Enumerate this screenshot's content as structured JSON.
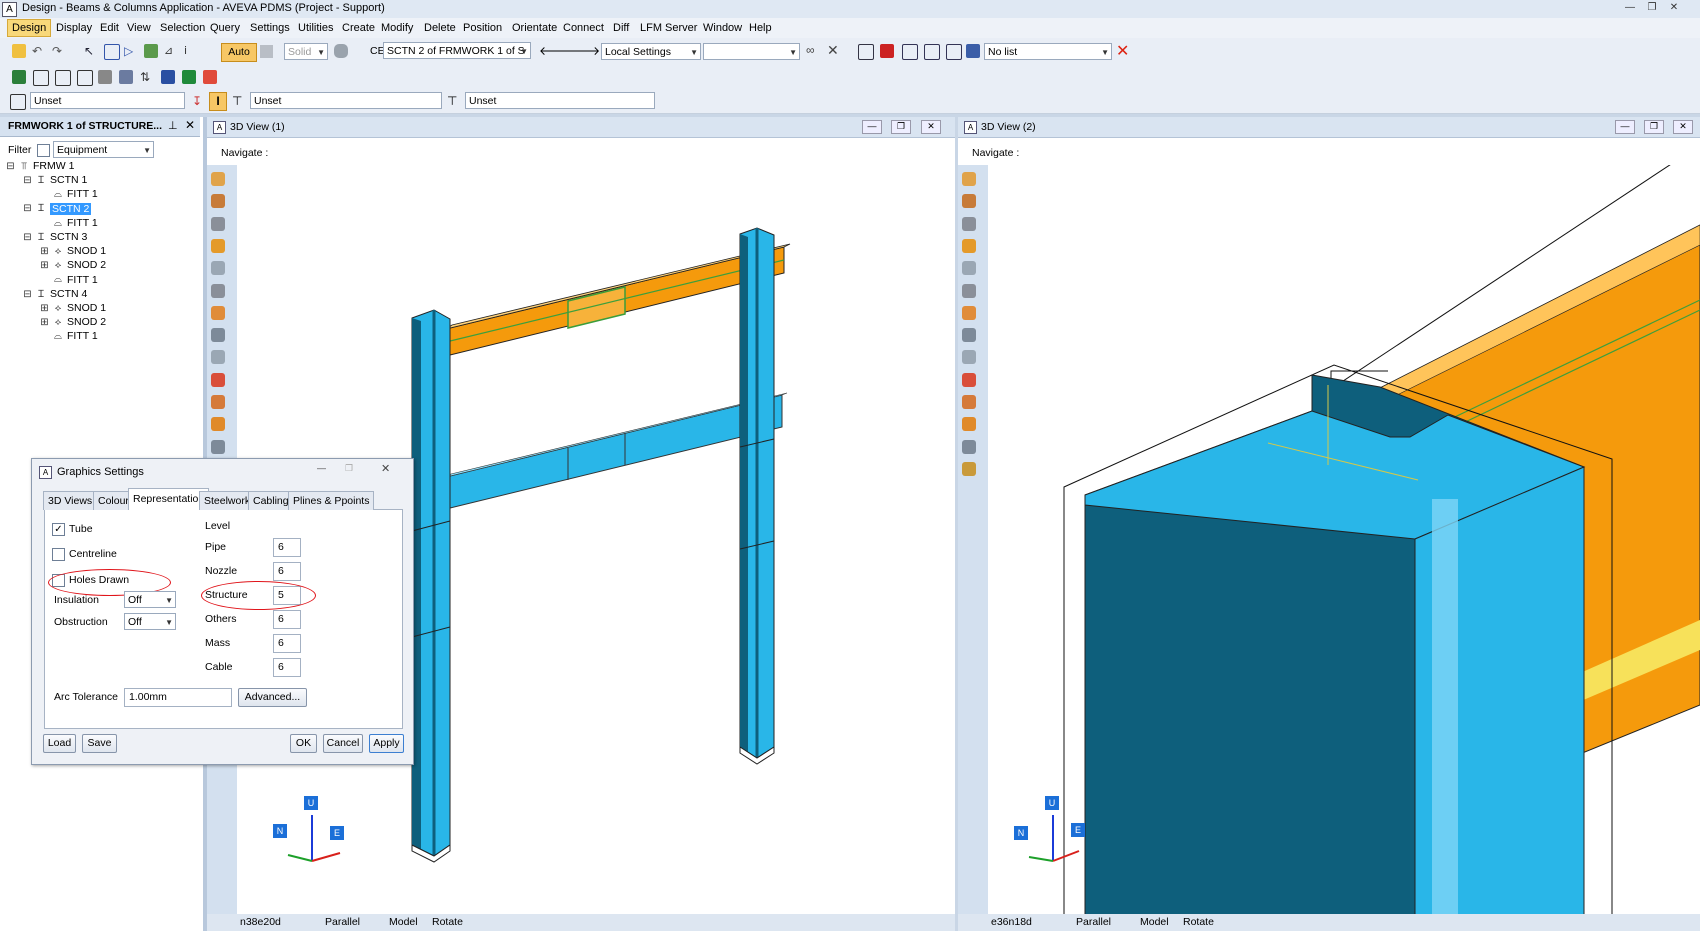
{
  "window": {
    "title": "Design - Beams & Columns Application - AVEVA PDMS (Project - Support)"
  },
  "menu": [
    "Design",
    "Display",
    "Edit",
    "View",
    "Selection",
    "Query",
    "Settings",
    "Utilities",
    "Create",
    "Modify",
    "Delete",
    "Position",
    "Orientate",
    "Connect",
    "Diff",
    "LFM Server",
    "Window",
    "Help"
  ],
  "toolbar": {
    "auto_label": "Auto",
    "solid_label": "Solid",
    "ce_label": "CE",
    "ce_value": "SCTN 2 of FRMWORK 1 of S",
    "settings_value": "Local Settings",
    "list_value": "No list",
    "unset1": "Unset",
    "unset2": "Unset",
    "unset3": "Unset"
  },
  "explorer": {
    "title": "FRMWORK 1 of STRUCTURE...",
    "filter_label": "Filter",
    "filter_value": "Equipment",
    "tree": [
      {
        "label": "FRMW 1",
        "level": 0,
        "icon": "frame-icon",
        "expander": "⊟",
        "selected": false
      },
      {
        "label": "SCTN 1",
        "level": 1,
        "icon": "beam-icon",
        "expander": "⊟",
        "selected": false
      },
      {
        "label": "FITT 1",
        "level": 2,
        "icon": "fitting-icon",
        "expander": "",
        "selected": false
      },
      {
        "label": "SCTN 2",
        "level": 1,
        "icon": "beam-icon",
        "expander": "⊟",
        "selected": true
      },
      {
        "label": "FITT 1",
        "level": 2,
        "icon": "fitting-icon",
        "expander": "",
        "selected": false
      },
      {
        "label": "SCTN 3",
        "level": 1,
        "icon": "beam-icon",
        "expander": "⊟",
        "selected": false
      },
      {
        "label": "SNOD 1",
        "level": 2,
        "icon": "node-icon",
        "expander": "⊞",
        "selected": false
      },
      {
        "label": "SNOD 2",
        "level": 2,
        "icon": "node-icon",
        "expander": "⊞",
        "selected": false
      },
      {
        "label": "FITT 1",
        "level": 2,
        "icon": "fitting-icon",
        "expander": "",
        "selected": false
      },
      {
        "label": "SCTN 4",
        "level": 1,
        "icon": "beam-icon",
        "expander": "⊟",
        "selected": false
      },
      {
        "label": "SNOD 1",
        "level": 2,
        "icon": "node-icon",
        "expander": "⊞",
        "selected": false
      },
      {
        "label": "SNOD 2",
        "level": 2,
        "icon": "node-icon",
        "expander": "⊞",
        "selected": false
      },
      {
        "label": "FITT 1",
        "level": 2,
        "icon": "fitting-icon",
        "expander": "",
        "selected": false
      }
    ]
  },
  "view1": {
    "title": "3D View (1)",
    "navigate_label": "Navigate :",
    "status": {
      "direction": "n38e20d",
      "projection": "Parallel",
      "mode": "Model",
      "action": "Rotate"
    }
  },
  "view2": {
    "title": "3D View (2)",
    "navigate_label": "Navigate :",
    "status": {
      "direction": "e36n18d",
      "projection": "Parallel",
      "mode": "Model",
      "action": "Rotate"
    }
  },
  "axes": {
    "up": "U",
    "north": "N",
    "east": "E"
  },
  "dialog": {
    "title": "Graphics Settings",
    "tabs": [
      "3D Views",
      "Colour",
      "Representation",
      "Steelwork",
      "Cabling",
      "Plines & Ppoints"
    ],
    "active_tab": "Representation",
    "tube": {
      "label": "Tube",
      "checked": true
    },
    "centreline": {
      "label": "Centreline",
      "checked": false
    },
    "holes_drawn": {
      "label": "Holes Drawn",
      "checked": false
    },
    "insulation": {
      "label": "Insulation",
      "value": "Off"
    },
    "obstruction": {
      "label": "Obstruction",
      "value": "Off"
    },
    "level_title": "Level",
    "levels": [
      {
        "label": "Pipe",
        "value": "6"
      },
      {
        "label": "Nozzle",
        "value": "6"
      },
      {
        "label": "Structure",
        "value": "5"
      },
      {
        "label": "Others",
        "value": "6"
      },
      {
        "label": "Mass",
        "value": "6"
      },
      {
        "label": "Cable",
        "value": "6"
      }
    ],
    "arc_tolerance": {
      "label": "Arc Tolerance",
      "value": "1.00mm"
    },
    "buttons": {
      "advanced": "Advanced...",
      "load": "Load",
      "save": "Save",
      "ok": "OK",
      "cancel": "Cancel",
      "apply": "Apply"
    }
  },
  "colors": {
    "steel_light": "#29b6e8",
    "steel_dark": "#0e5f7c",
    "beam_orange": "#f59a0c",
    "highlight": "#e0151b",
    "selection": "#3399ff"
  }
}
